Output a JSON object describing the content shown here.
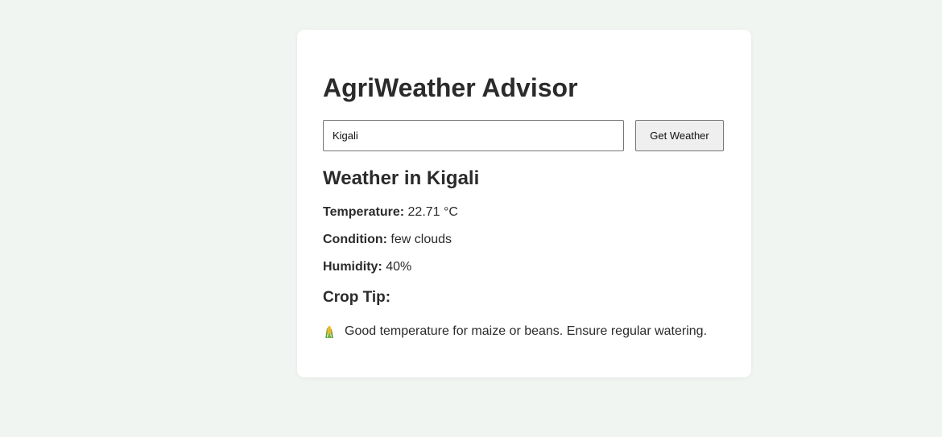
{
  "app": {
    "title": "AgriWeather Advisor"
  },
  "search": {
    "value": "Kigali",
    "button_label": "Get Weather"
  },
  "weather": {
    "heading": "Weather in Kigali",
    "temperature_label": "Temperature:",
    "temperature_value": "22.71 °C",
    "condition_label": "Condition:",
    "condition_value": "few clouds",
    "humidity_label": "Humidity:",
    "humidity_value": "40%"
  },
  "crop_tip": {
    "heading": "Crop Tip:",
    "icon": "corn-icon",
    "text": "Good temperature for maize or beans. Ensure regular watering."
  },
  "colors": {
    "background": "#f1f5f2",
    "card": "#ffffff",
    "text": "#2b2b2b",
    "button": "#efefef"
  }
}
